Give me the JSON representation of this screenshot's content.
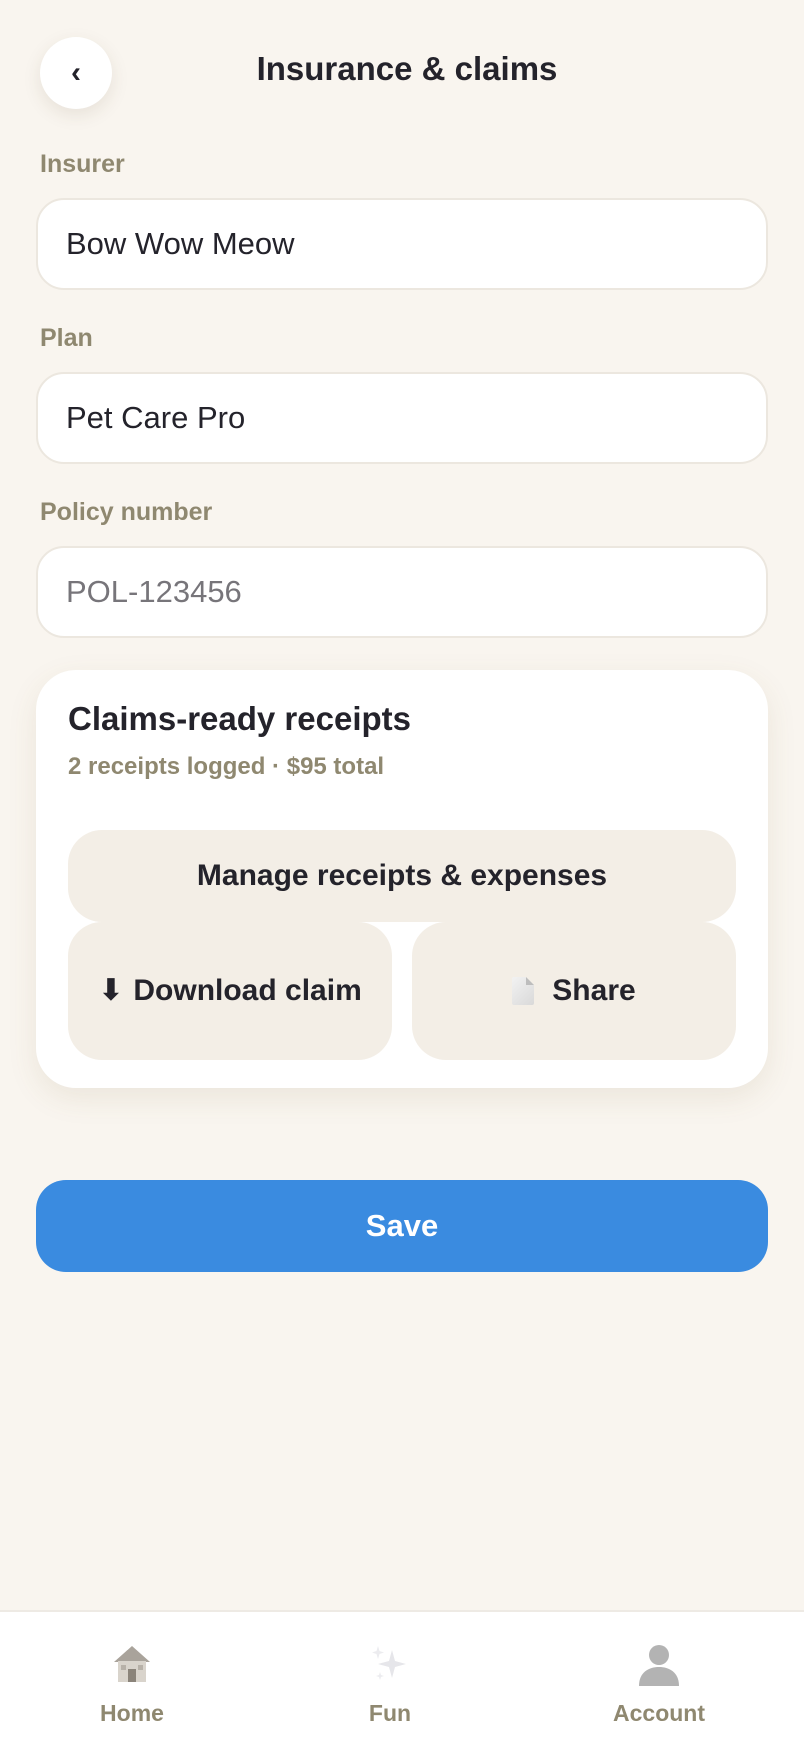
{
  "header": {
    "back_label": "‹",
    "title": "Insurance & claims"
  },
  "form": {
    "insurer": {
      "label": "Insurer",
      "value": "Bow Wow Meow"
    },
    "plan": {
      "label": "Plan",
      "value": "Pet Care Pro"
    },
    "policy": {
      "label": "Policy number",
      "value": "",
      "placeholder": "POL-123456"
    }
  },
  "receipts": {
    "title": "Claims-ready receipts",
    "summary": "2 receipts logged · $95 total",
    "manage_label": "Manage receipts & expenses",
    "download_icon": "⬇",
    "download_label": "Download claim",
    "share_icon": "document-icon",
    "share_label": "Share"
  },
  "save_label": "Save",
  "nav": {
    "items": [
      {
        "label": "Home",
        "icon": "house-icon"
      },
      {
        "label": "Fun",
        "icon": "sparkles-icon"
      },
      {
        "label": "Account",
        "icon": "person-icon"
      }
    ]
  },
  "colors": {
    "background": "#f9f5ef",
    "accent": "#3a8be0",
    "muted_label": "#8f8870",
    "soft_button": "#f3eee6"
  }
}
